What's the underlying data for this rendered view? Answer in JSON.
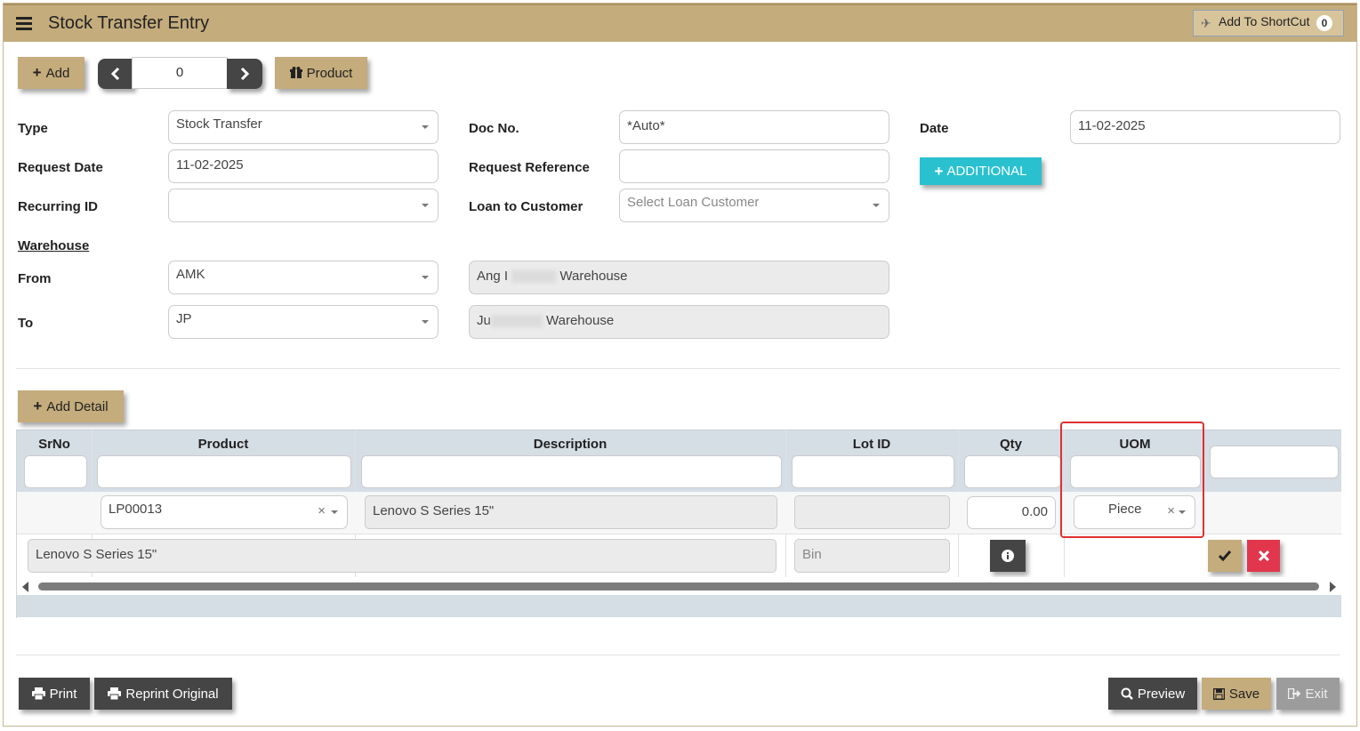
{
  "header": {
    "title": "Stock Transfer Entry",
    "shortcut_label": "Add To ShortCut",
    "shortcut_count": "0"
  },
  "toolbar": {
    "add_label": "Add",
    "record_index": "0",
    "product_label": "Product"
  },
  "form": {
    "type_label": "Type",
    "type_value": "Stock Transfer",
    "doc_no_label": "Doc No.",
    "doc_no_value": "*Auto*",
    "date_label": "Date",
    "date_value": "11-02-2025",
    "request_date_label": "Request Date",
    "request_date_value": "11-02-2025",
    "request_reference_label": "Request Reference",
    "request_reference_value": "",
    "additional_label": "ADDITIONAL",
    "recurring_id_label": "Recurring ID",
    "recurring_id_value": "",
    "loan_label": "Loan to Customer",
    "loan_placeholder": "Select Loan Customer",
    "warehouse_heading": "Warehouse",
    "from_label": "From",
    "from_code": "AMK",
    "from_name_prefix": "Ang I",
    "from_name_suffix": "Warehouse",
    "to_label": "To",
    "to_code": "JP",
    "to_name_prefix": "Ju",
    "to_name_suffix": "Warehouse"
  },
  "detail": {
    "add_detail_label": "Add Detail",
    "columns": [
      "SrNo",
      "Product",
      "Description",
      "Lot ID",
      "Qty",
      "UOM"
    ],
    "row": {
      "product": "LP00013",
      "description": "Lenovo S Series 15\"",
      "lot_id": "",
      "qty": "0.00",
      "uom": "Piece"
    },
    "expanded": {
      "description": "Lenovo S Series 15\"",
      "bin_placeholder": "Bin"
    }
  },
  "footer": {
    "print_label": "Print",
    "reprint_label": "Reprint Original",
    "preview_label": "Preview",
    "save_label": "Save",
    "exit_label": "Exit"
  },
  "colors": {
    "header_tan": "#c4ac7c",
    "dark_button": "#454545",
    "cyan_button": "#29c1cf",
    "red_button": "#e2364c",
    "grid_header": "#d5dde5",
    "highlight": "#e03030"
  }
}
